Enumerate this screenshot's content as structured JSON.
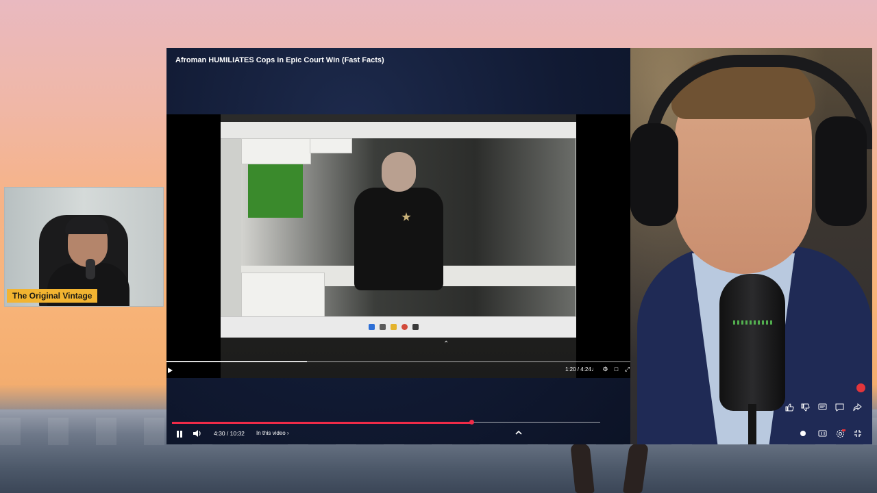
{
  "overlay": {
    "streamer_name": "The Original Vintage"
  },
  "player": {
    "title": "Afroman HUMILIATES Cops in Epic Court Win (Fast Facts)",
    "current_time": "4:30",
    "separator": " / ",
    "duration": "10:32",
    "chapter_label": "In this video",
    "progress_fraction": 0.699
  },
  "inner_player": {
    "time": "1:20 / 4:24",
    "progress_fraction": 0.303
  },
  "icons": {
    "pause": "pause-icon",
    "volume": "volume-icon",
    "chapter_chevron": "chevron-right-icon",
    "expand": "chevron-up-icon",
    "like": "thumbs-up-icon",
    "dislike": "thumbs-down-icon",
    "comment": "comment-icon",
    "chat": "chat-icon",
    "share": "share-icon",
    "autoplay": "autoplay-toggle-icon",
    "captions": "captions-icon",
    "settings": "settings-icon",
    "exit_fullscreen": "exit-fullscreen-icon"
  },
  "colors": {
    "progress": "#ef2b48",
    "badge": "#f2b431"
  }
}
